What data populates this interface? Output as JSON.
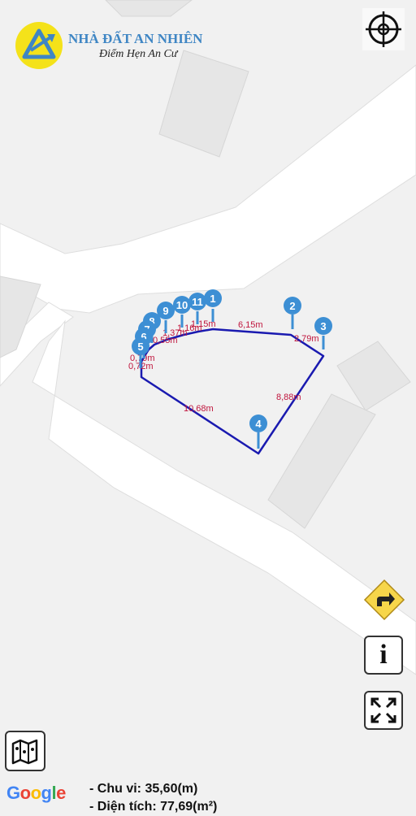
{
  "brand": {
    "name": "NHÀ ĐẤT AN NHIÊN",
    "slogan": "Điểm Hẹn An Cư",
    "colors": {
      "name": "#3f86c4",
      "logo_bg": "#f4e21a"
    }
  },
  "controls": {
    "locate": {
      "icon": "crosshair-icon"
    },
    "directions": {
      "icon": "directions-arrow-icon"
    },
    "info": {
      "icon": "info-icon",
      "label": "i"
    },
    "fullscreen": {
      "icon": "fullscreen-icon"
    },
    "map_type": {
      "icon": "map-layers-icon"
    }
  },
  "attribution": {
    "google_text": "Google"
  },
  "plot": {
    "line_color": "#1a1ab0",
    "pin_color": "#3d8fd4",
    "label_color": "#c0153d",
    "pins": [
      "1",
      "2",
      "3",
      "4",
      "5",
      "6",
      "7",
      "8",
      "9",
      "10",
      "11"
    ],
    "segments": [
      "6,15m",
      "2,79m",
      "8,88m",
      "10,68m",
      "0,72m",
      "0,79m",
      "0,55m",
      "1,37m",
      "1,16m",
      "1,15m"
    ]
  },
  "summary": {
    "perimeter": "- Chu vi: 35,60(m)",
    "area": "- Diện tích: 77,69(m²)"
  }
}
